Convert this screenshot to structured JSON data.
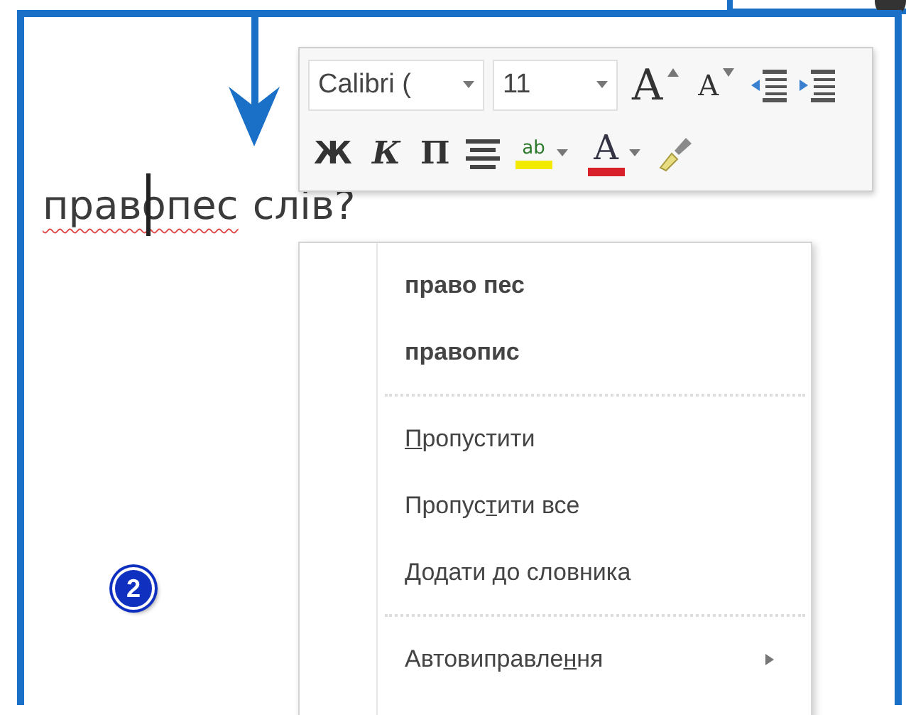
{
  "document": {
    "misspelled_word": "правопес",
    "rest": "слів?"
  },
  "mini_toolbar": {
    "font": "Calibri (",
    "size": "11",
    "row_1": [
      {
        "kind": "grow-font",
        "label": "A"
      },
      {
        "kind": "shrink-font",
        "label": "A"
      },
      {
        "kind": "outdent"
      },
      {
        "kind": "indent"
      }
    ],
    "row_2": [
      {
        "kind": "bold",
        "label": "Ж"
      },
      {
        "kind": "italic",
        "label": "К"
      },
      {
        "kind": "underline",
        "label": "П"
      },
      {
        "kind": "center"
      },
      {
        "kind": "highlight",
        "label": "ab",
        "color": "#f2ea00"
      },
      {
        "kind": "font-color",
        "label": "A",
        "color": "#d8202a"
      },
      {
        "kind": "painter"
      }
    ]
  },
  "context_menu": [
    {
      "kind": "suggestion",
      "label": "право пес"
    },
    {
      "kind": "suggestion",
      "label": "правопис"
    },
    {
      "kind": "separator"
    },
    {
      "kind": "command",
      "key": "П",
      "after": "ропустити"
    },
    {
      "kind": "command",
      "before": "Пропус",
      "key": "т",
      "after": "ити все"
    },
    {
      "kind": "command",
      "key": "Д",
      "after": "одати до словника"
    },
    {
      "kind": "separator"
    },
    {
      "kind": "submenu",
      "before": "Автовиправле",
      "key": "н",
      "after": "ня"
    }
  ],
  "step_badge": "2"
}
